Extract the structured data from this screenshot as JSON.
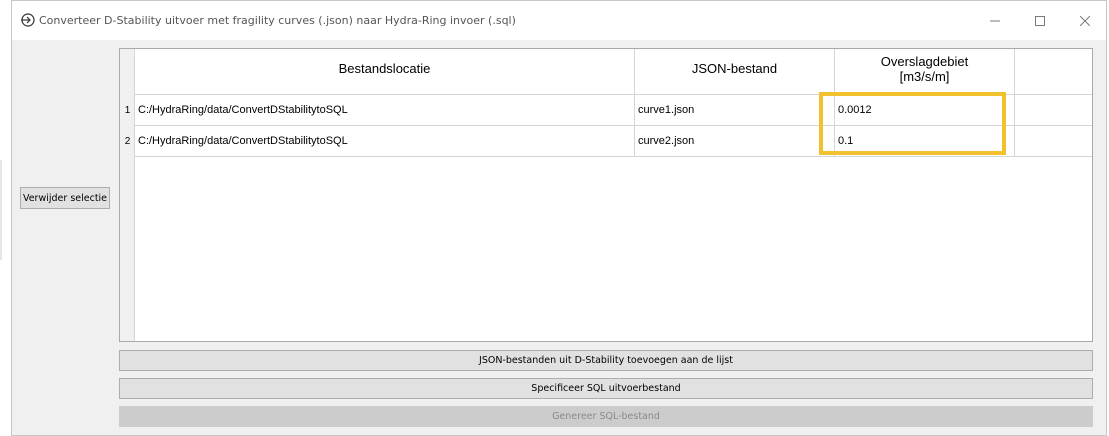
{
  "window": {
    "title": "Converteer D-Stability uitvoer met fragility curves (.json) naar Hydra-Ring invoer (.sql)",
    "minimize_icon": "minimize-icon",
    "maximize_icon": "maximize-icon",
    "close_icon": "close-icon",
    "app_icon": "arrow-circle-icon"
  },
  "buttons": {
    "remove_selection": "Verwijder selectie",
    "add_json": "JSON-bestanden uit D-Stability toevoegen aan de lijst",
    "specify_sql": "Specificeer SQL uitvoerbestand",
    "generate_sql": "Genereer SQL-bestand"
  },
  "table": {
    "columns": [
      "Bestandslocatie",
      "JSON-bestand",
      "Overslagdebiet",
      "[m3/s/m]"
    ],
    "rows": [
      {
        "index": "1",
        "location": "C:/HydraRing/data/ConvertDStabilitytoSQL",
        "file": "curve1.json",
        "discharge": "0.0012"
      },
      {
        "index": "2",
        "location": "C:/HydraRing/data/ConvertDStabilitytoSQL",
        "file": "curve2.json",
        "discharge": "0.1"
      }
    ]
  },
  "colors": {
    "highlight": "#f2c12e",
    "window_bg": "#f0f0f0",
    "disabled_text": "#8a8a8a"
  }
}
